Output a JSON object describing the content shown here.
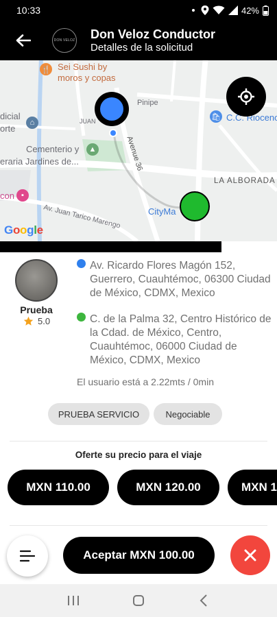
{
  "status_bar": {
    "time": "10:33",
    "battery": "42%",
    "icons": [
      "notification-dot-icon",
      "location-icon",
      "wifi-icon",
      "signal-icon",
      "battery-icon"
    ]
  },
  "header": {
    "back_icon": "arrow-left-icon",
    "logo_text": "DON VELOZ",
    "title": "Don Veloz Conductor",
    "subtitle": "Detalles de la solicitud"
  },
  "map": {
    "labels": {
      "sushi": "Sei Sushi by moros y copas",
      "cementerio_1": "Cementerio y",
      "cementerio_2": "eraria Jardines de...",
      "avenue": "Avenue 36",
      "alborada": "LA ALBORADA",
      "citymarket": "CityMa",
      "juan_tarico": "Av. Juan Tarico Marengo",
      "cc_rioceno": "C.C. Rioceno",
      "left_edge_1": "dicial",
      "left_edge_2": "orte",
      "left_edge_3": "con",
      "juan": "JUAN",
      "pinipe": "Pinipe"
    },
    "google": [
      "G",
      "o",
      "o",
      "g",
      "l",
      "e"
    ],
    "google_colors": [
      "#4285F4",
      "#EA4335",
      "#FBBC05",
      "#4285F4",
      "#34A853",
      "#EA4335"
    ],
    "origin_color": "#3a86ff",
    "destination_color": "#1fba2e",
    "locate_icon": "crosshair-icon"
  },
  "progress": {
    "value": 0.8
  },
  "request": {
    "user": {
      "name": "Prueba",
      "rating": "5.0",
      "star_color": "#f4a21d"
    },
    "pickup": {
      "dot_color": "#2f80ed",
      "address": "Av. Ricardo Flores Magón 152, Guerrero, Cuauhtémoc, 06300 Ciudad de México, CDMX, Mexico"
    },
    "dropoff": {
      "dot_color": "#3db63e",
      "address": "C. de la Palma 32, Centro Histórico de la Cdad. de México, Centro, Cuauhtémoc, 06000 Ciudad de México, CDMX, Mexico"
    },
    "distance": "El usuario está a 2.22mts / 0min",
    "chips": [
      "PRUEBA SERVICIO",
      "Negociable"
    ]
  },
  "offer": {
    "title": "Oferte su precio para el viaje",
    "prices": [
      "MXN 110.00",
      "MXN 120.00",
      "MXN 1"
    ]
  },
  "actions": {
    "menu_icon": "menu-lines-icon",
    "accept_label": "Aceptar MXN 100.00",
    "cancel_icon": "close-icon",
    "cancel_color": "#f2463d"
  },
  "nav": {
    "icons": [
      "recents-icon",
      "home-icon",
      "back-icon"
    ]
  }
}
